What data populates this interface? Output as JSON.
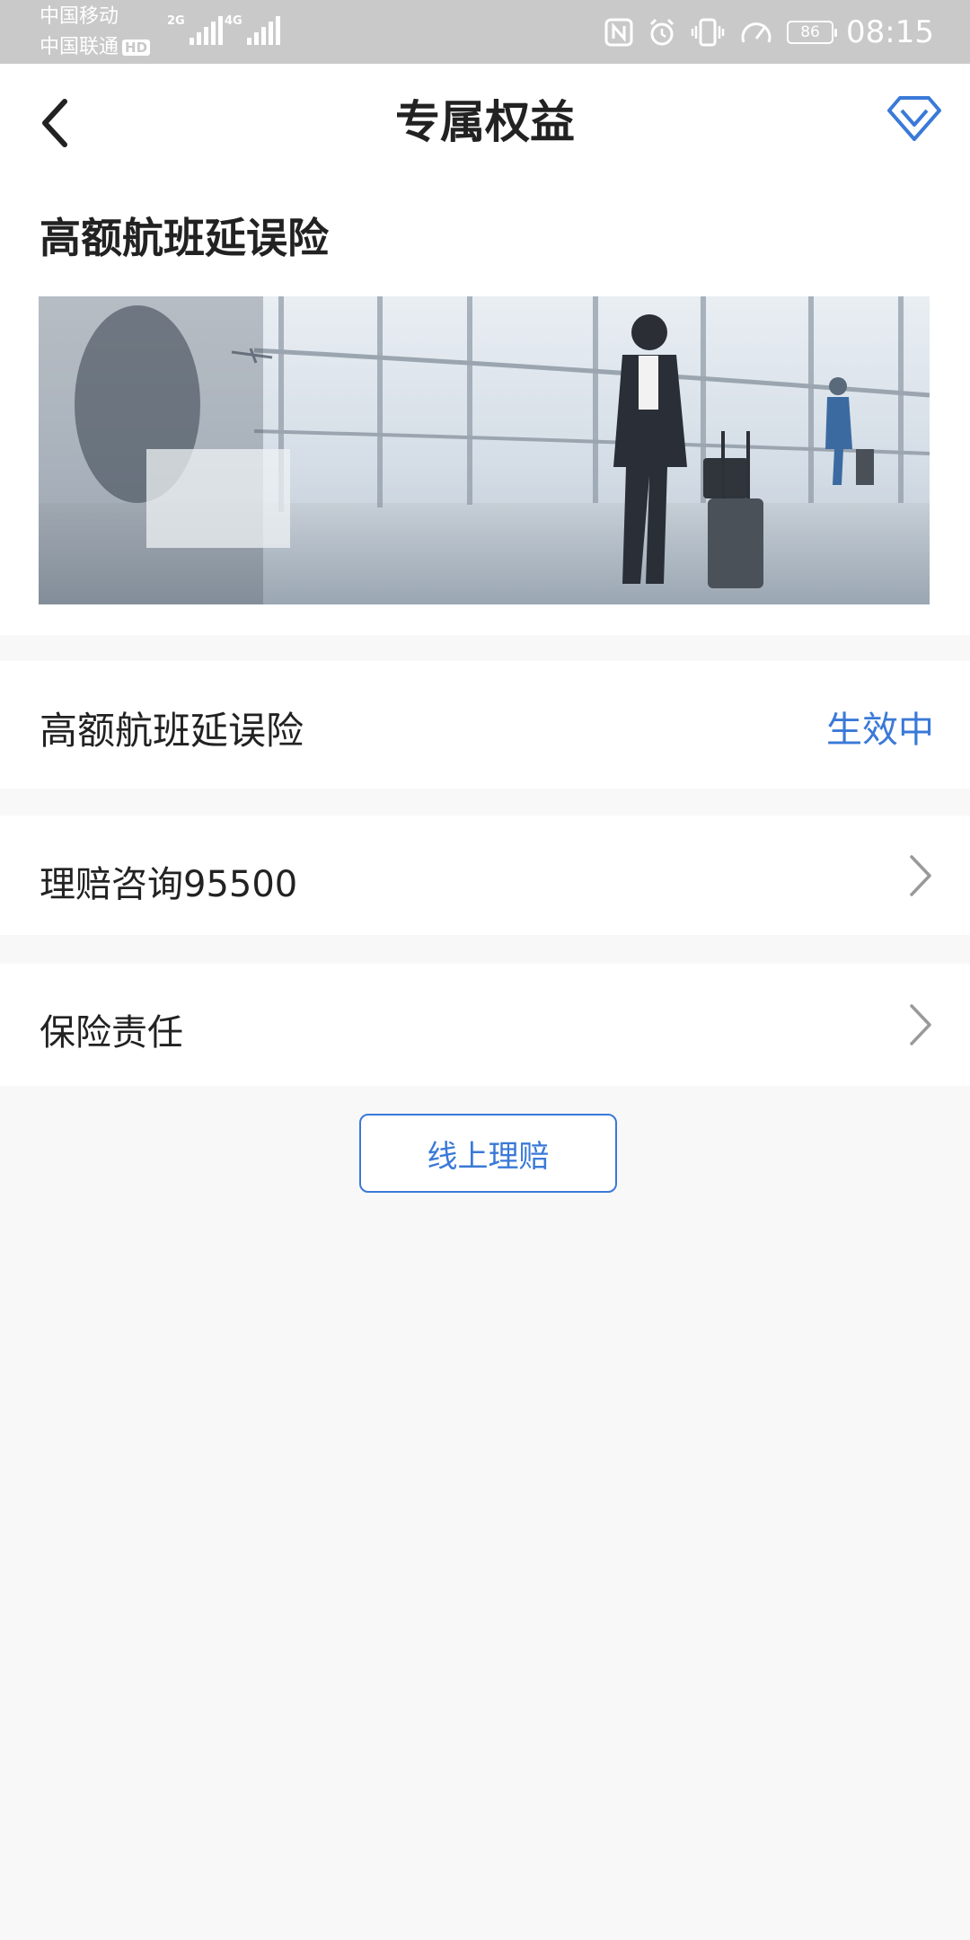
{
  "status_bar": {
    "carrier_1": "中国移动",
    "carrier_2": "中国联通",
    "hd_badge": "HD",
    "signal_1_label": "2G",
    "signal_2_label": "4G",
    "battery_level": "86",
    "time": "08:15"
  },
  "header": {
    "title": "专属权益"
  },
  "benefit": {
    "card_title": "高额航班延误险",
    "banner_alt": "airport passenger banner"
  },
  "rows": [
    {
      "label": "高额航班延误险",
      "status": "生效中"
    },
    {
      "label": "理赔咨询95500"
    },
    {
      "label": "保险责任"
    }
  ],
  "actions": {
    "online_claim": "线上理赔"
  },
  "colors": {
    "accent": "#3a79d8",
    "statusbar_bg": "#c9c9c9",
    "page_bg": "#f8f8f8"
  }
}
